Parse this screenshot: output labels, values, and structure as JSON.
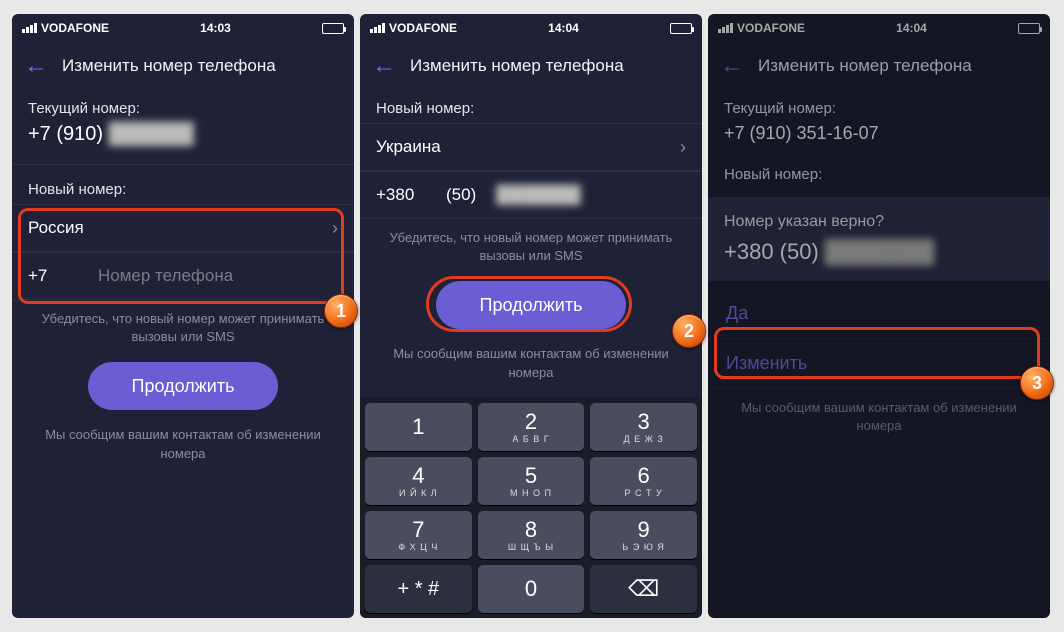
{
  "status": {
    "carrier": "VODAFONE",
    "time1": "14:03",
    "time2": "14:04",
    "time3": "14:04"
  },
  "nav": {
    "title": "Изменить номер телефона"
  },
  "s1": {
    "current_label": "Текущий номер:",
    "current_number": "+7 (910)",
    "new_label": "Новый номер:",
    "country": "Россия",
    "prefix": "+7",
    "placeholder": "Номер телефона",
    "hint": "Убедитесь, что новый номер может принимать вызовы или SMS",
    "continue": "Продолжить",
    "sub": "Мы сообщим вашим контактам об изменении номера"
  },
  "s2": {
    "new_label": "Новый номер:",
    "country": "Украина",
    "prefix": "+380",
    "area": "(50)",
    "hint": "Убедитесь, что новый номер может принимать вызовы или SMS",
    "continue": "Продолжить",
    "sub": "Мы сообщим вашим контактам об изменении номера"
  },
  "s3": {
    "current_label": "Текущий номер:",
    "current_number": "+7 (910) 351-16-07",
    "new_label": "Новый номер:",
    "confirm_q": "Номер указан верно?",
    "confirm_num": "+380 (50)",
    "yes": "Да",
    "edit": "Изменить",
    "sub": "Мы сообщим вашим контактам об изменении номера"
  },
  "keypad": [
    {
      "d": "1",
      "l": ""
    },
    {
      "d": "2",
      "l": "А Б В Г"
    },
    {
      "d": "3",
      "l": "Д Е Ж З"
    },
    {
      "d": "4",
      "l": "И Й К Л"
    },
    {
      "d": "5",
      "l": "М Н О П"
    },
    {
      "d": "6",
      "l": "Р С Т У"
    },
    {
      "d": "7",
      "l": "Ф Х Ц Ч"
    },
    {
      "d": "8",
      "l": "Ш Щ Ъ Ы"
    },
    {
      "d": "9",
      "l": "Ь Э Ю Я"
    },
    {
      "d": "+ * #",
      "l": "",
      "dark": true,
      "small": true
    },
    {
      "d": "0",
      "l": ""
    },
    {
      "d": "⌫",
      "l": "",
      "dark": true
    }
  ],
  "badges": {
    "b1": "1",
    "b2": "2",
    "b3": "3"
  }
}
